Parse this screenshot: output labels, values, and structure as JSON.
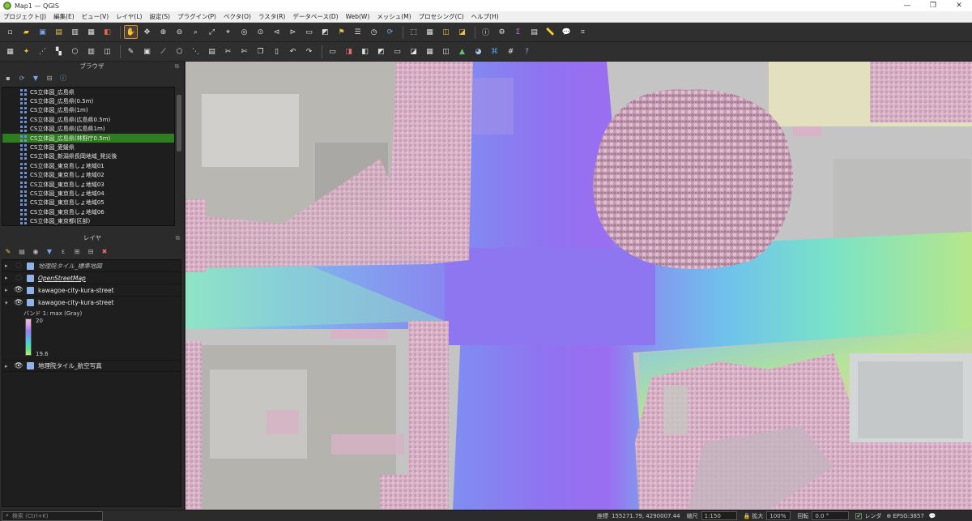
{
  "window": {
    "title": "Map1 — QGIS",
    "controls": [
      "—",
      "❐",
      "✕"
    ]
  },
  "menu": [
    "プロジェクト(J)",
    "編集(E)",
    "ビュー(V)",
    "レイヤ(L)",
    "設定(S)",
    "プラグイン(P)",
    "ベクタ(O)",
    "ラスタ(R)",
    "データベース(D)",
    "Web(W)",
    "メッシュ(M)",
    "プロセシング(C)",
    "ヘルプ(H)"
  ],
  "browser": {
    "title": "ブラウザ",
    "items": [
      "CS立体図_広島県",
      "CS立体図_広島県(0.5m)",
      "CS立体図_広島県(1m)",
      "CS立体図_広島県(広島県0.5m)",
      "CS立体図_広島県(広島県1m)",
      "CS立体図_広島県(林野庁0.5m)",
      "CS立体図_愛媛県",
      "CS立体図_新潟県長岡地域_発災後",
      "CS立体図_東京島しょ地域01",
      "CS立体図_東京島しょ地域02",
      "CS立体図_東京島しょ地域03",
      "CS立体図_東京島しょ地域04",
      "CS立体図_東京島しょ地域05",
      "CS立体図_東京島しょ地域06",
      "CS立体図_東京都(区部)"
    ],
    "selected_index": 5
  },
  "layers": {
    "title": "レイヤ",
    "items": [
      {
        "name": "地理院タイル_標準地図",
        "visible": false,
        "style": "italic"
      },
      {
        "name": "OpenStreetMap",
        "visible": false,
        "style": "link"
      },
      {
        "name": "kawagoe-city-kura-street",
        "visible": true,
        "style": "normal"
      },
      {
        "name": "kawagoe-city-kura-street",
        "visible": true,
        "style": "normal"
      },
      {
        "name": "地理院タイル_航空写真",
        "visible": true,
        "style": "normal"
      }
    ],
    "legend": {
      "band_label": "バンド 1: max (Gray)",
      "max": "20",
      "min": "19.6"
    }
  },
  "status": {
    "search_placeholder": "検索 (Ctrl+K)",
    "coordinate_label": "座標",
    "coordinate_value": "155271.79, 4290007.44",
    "scale_label": "縮尺",
    "scale_value": "1:150",
    "magnifier_label": "拡大",
    "magnifier_value": "100%",
    "rotation_label": "回転",
    "rotation_value": "0.0 °",
    "render_label": "レンダ",
    "crs": "EPSG:3857"
  },
  "colors": {
    "selected_row": "#2e7d1f",
    "panel_bg": "#2b2b2b",
    "road": "#8f7cf0",
    "building": "#d9b3c8"
  }
}
